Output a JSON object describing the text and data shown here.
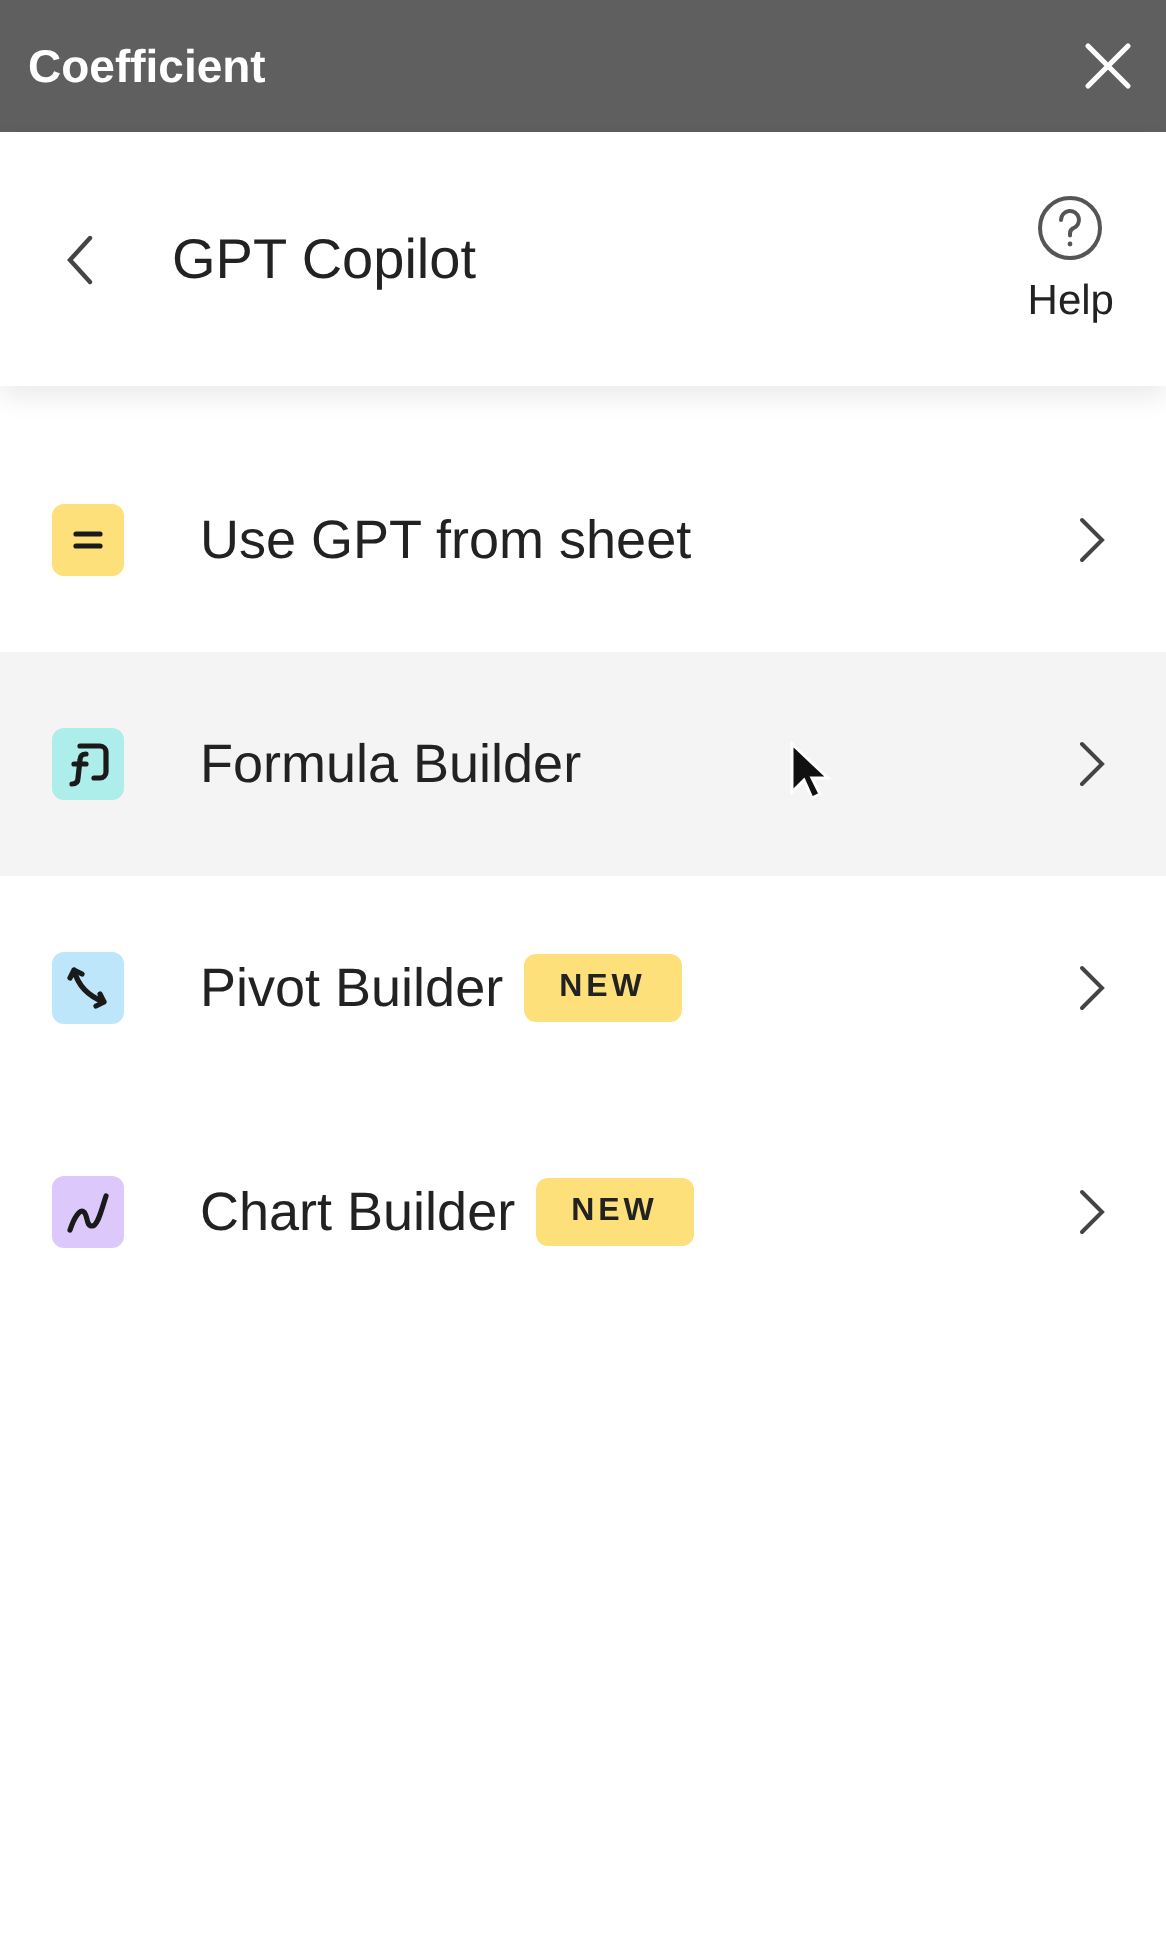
{
  "window": {
    "title": "Coefficient"
  },
  "header": {
    "title": "GPT Copilot",
    "help_label": "Help"
  },
  "items": [
    {
      "label": "Use GPT from sheet",
      "kind": "equals",
      "color": "#fde07a",
      "highlighted": false
    },
    {
      "label": "Formula Builder",
      "kind": "formula",
      "color": "#aeeeea",
      "highlighted": true
    },
    {
      "label": "Pivot Builder",
      "kind": "pivot",
      "color": "#bde6fb",
      "highlighted": false,
      "badge": "NEW"
    },
    {
      "label": "Chart Builder",
      "kind": "chart",
      "color": "#dcc8fb",
      "highlighted": false,
      "badge": "NEW"
    }
  ]
}
